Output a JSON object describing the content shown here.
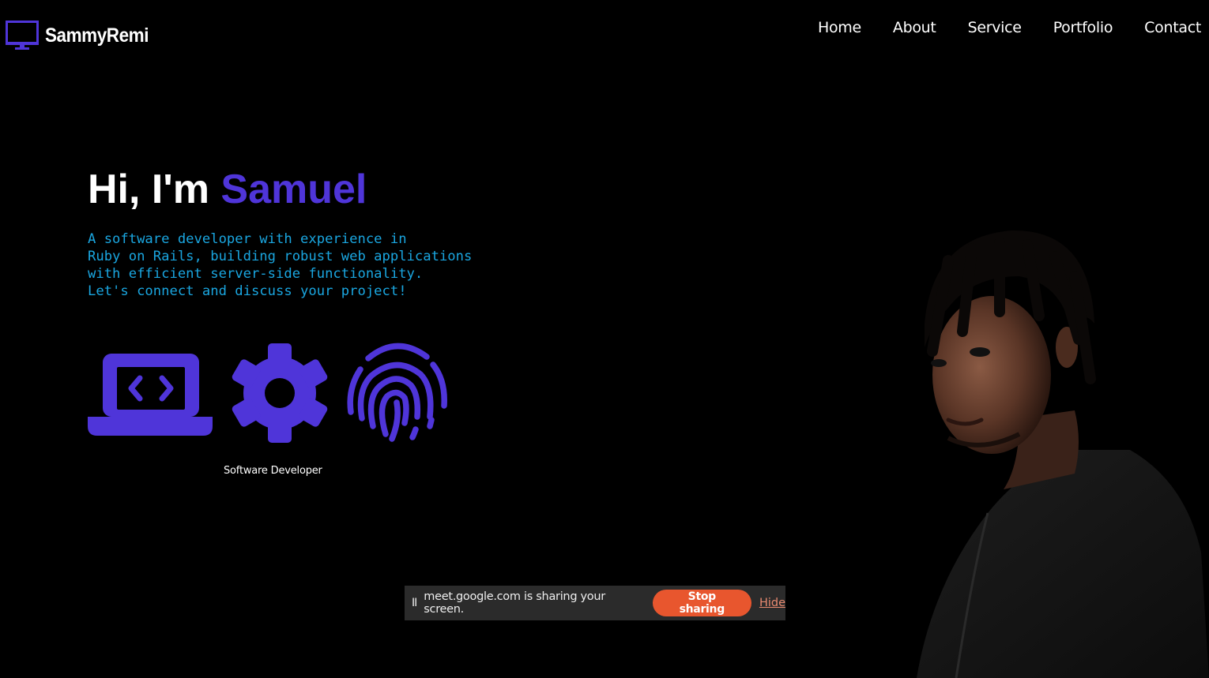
{
  "header": {
    "brand": "SammyRemi",
    "brand_icon": "monitor-icon",
    "nav": [
      {
        "label": "Home"
      },
      {
        "label": "About"
      },
      {
        "label": "Service"
      },
      {
        "label": "Portfolio"
      },
      {
        "label": "Contact"
      }
    ]
  },
  "hero": {
    "greeting": "Hi, I'm ",
    "name": "Samuel",
    "intro_lines": [
      "A software developer with experience in",
      "Ruby on Rails, building robust web applications",
      "with efficient server-side functionality.",
      "Let's connect and discuss your project!"
    ],
    "icons": [
      "laptop-code-icon",
      "gear-icon",
      "fingerprint-icon"
    ],
    "role": "Software Developer"
  },
  "share_bar": {
    "pause_glyph": "II",
    "message": "meet.google.com is sharing your screen.",
    "stop_label": "Stop sharing",
    "hide_label": "Hide"
  },
  "colors": {
    "background": "#000000",
    "accent": "#4f35d9",
    "intro_text": "#1aa6e0",
    "stop_button": "#e8562e"
  }
}
